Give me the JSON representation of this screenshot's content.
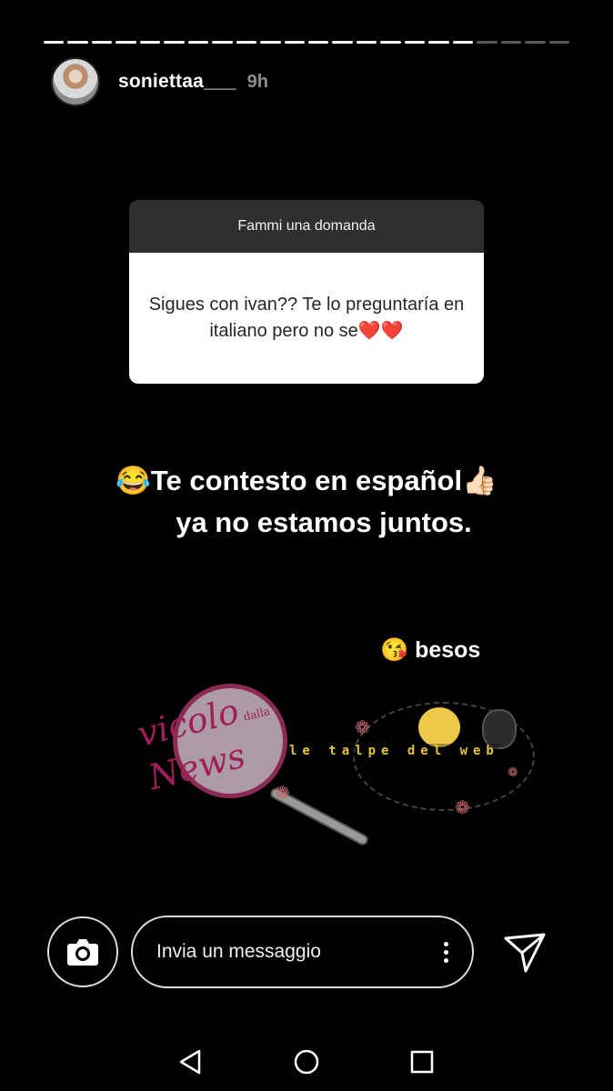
{
  "story": {
    "segments_total": 22,
    "segments_viewed": 18,
    "username": "soniettaa___",
    "time_ago": "9h"
  },
  "question_sticker": {
    "header": "Fammi una domanda",
    "question": "Sigues con ivan?? Te lo preguntaría en italiano pero no se❤️❤️"
  },
  "answer": {
    "line1": "😂Te contesto en español👍🏻",
    "line2": "ya no estamos juntos.",
    "signoff": "😘 besos"
  },
  "watermark": {
    "script_top": "vicolo",
    "script_small": "dalla",
    "script_bottom": "News",
    "banner": "le talpe del web"
  },
  "reply_bar": {
    "placeholder": "Invia un messaggio"
  },
  "icons": {
    "camera": "camera-icon",
    "more": "more-vertical-icon",
    "send": "send-direct-icon",
    "back": "nav-back-icon",
    "home": "nav-home-icon",
    "recents": "nav-recents-icon"
  }
}
